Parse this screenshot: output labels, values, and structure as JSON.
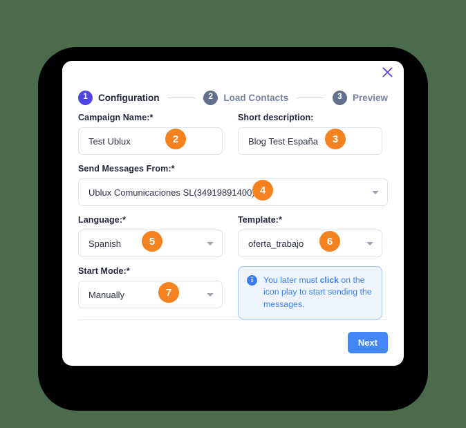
{
  "dialog": {
    "close_icon": "close-icon"
  },
  "stepper": {
    "steps": [
      {
        "number": "1",
        "label": "Configuration",
        "state": "active"
      },
      {
        "number": "2",
        "label": "Load Contacts",
        "state": "pending"
      },
      {
        "number": "3",
        "label": "Preview",
        "state": "pending"
      }
    ]
  },
  "form": {
    "campaign_name": {
      "label": "Campaign Name:*",
      "value": "Test Ublux",
      "annotation": "2"
    },
    "short_description": {
      "label": "Short description:",
      "value": "Blog Test España",
      "annotation": "3"
    },
    "send_messages_from": {
      "label": "Send Messages From:*",
      "value": "Ublux Comunicaciones SL(34919891400)",
      "annotation": "4"
    },
    "language": {
      "label": "Language:*",
      "value": "Spanish",
      "annotation": "5"
    },
    "template": {
      "label": "Template:*",
      "value": "oferta_trabajo",
      "annotation": "6"
    },
    "start_mode": {
      "label": "Start Mode:*",
      "value": "Manually",
      "annotation": "7"
    }
  },
  "info_callout": {
    "icon": "info-icon",
    "text_part1": "You later must ",
    "text_bold": "click",
    "text_part2": " on the icon play to start sending the messages."
  },
  "footer": {
    "next_label": "Next"
  },
  "colors": {
    "page_background": "#4a6b4c",
    "device_frame": "#000000",
    "dialog_background": "#ffffff",
    "step_active": "#5046e5",
    "step_pending": "#63708b",
    "annotation_badge": "#f58220",
    "primary_button": "#4287f5",
    "info_blue": "#3b7ef0",
    "info_background": "#eff5ff",
    "close_icon": "#5046e5"
  }
}
